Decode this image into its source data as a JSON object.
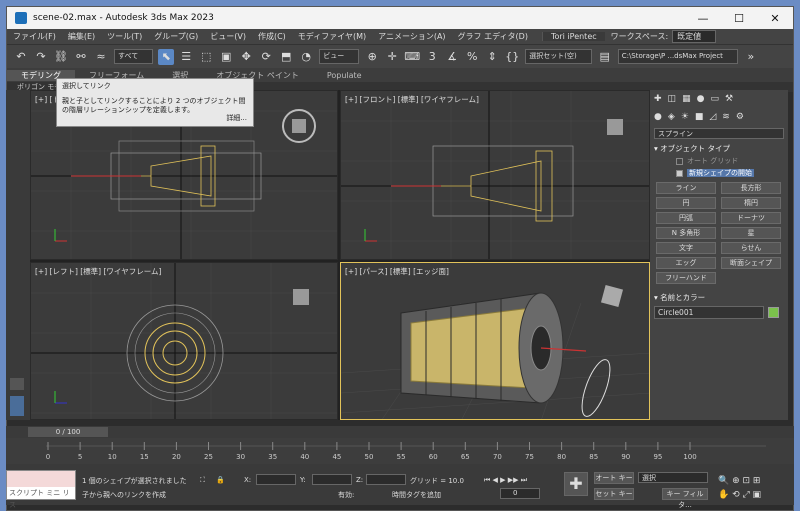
{
  "window": {
    "title": "scene-02.max - Autodesk 3ds Max 2023",
    "controls": [
      "—",
      "☐",
      "✕"
    ]
  },
  "menubar": {
    "items": [
      "ファイル(F)",
      "編集(E)",
      "ツール(T)",
      "グループ(G)",
      "ビュー(V)",
      "作成(C)",
      "モディファイヤ(M)",
      "アニメーション(A)",
      "グラフ エディタ(D)"
    ],
    "user": "Tori iPentec",
    "workspace_label": "ワークスペース:",
    "workspace_value": "既定値"
  },
  "toolbar": {
    "selection_filter": "すべて",
    "view_dropdown": "ビュー",
    "selection_set": "選択セット(空)",
    "project_path": "C:\\Storage\\P ...dsMax Project"
  },
  "ribbon": {
    "tabs": [
      "モデリング",
      "フリーフォーム",
      "選択",
      "オブジェクト ペイント",
      "Populate"
    ],
    "sub": "ポリゴン モデリ"
  },
  "tooltip": {
    "title": "選択してリンク",
    "body": "親と子としてリンクすることにより 2 つのオブジェクト間の階層リレーションシップを定義します。",
    "more": "詳細..."
  },
  "viewports": [
    {
      "label": "[+] [トップ] [標準] [ワイヤフレーム]",
      "cube": "上"
    },
    {
      "label": "[+] [フロント] [標準] [ワイヤフレーム]",
      "cube": "前"
    },
    {
      "label": "[+] [レフト] [標準] [ワイヤフレーム]",
      "cube": "左"
    },
    {
      "label": "[+] [パース] [標準] [エッジ面]",
      "cube": ""
    }
  ],
  "command_panel": {
    "category": "スプライン",
    "rollout_object_type": "オブジェクト タイプ",
    "auto_grid": "オート グリッド",
    "start_new_shape": "新規シェイプの開始",
    "buttons": [
      "ライン",
      "長方形",
      "円",
      "楕円",
      "円弧",
      "ドーナツ",
      "N 多角形",
      "星",
      "文字",
      "らせん",
      "エッグ",
      "断面シェイプ",
      "フリーハンド"
    ],
    "rollout_name_color": "名前とカラー",
    "object_name": "Circle001",
    "object_color": "#7bc14c"
  },
  "timeline": {
    "frame_display": "0 / 100",
    "ticks": [
      "0",
      "5",
      "10",
      "15",
      "20",
      "25",
      "30",
      "35",
      "40",
      "45",
      "50",
      "55",
      "60",
      "65",
      "70",
      "75",
      "80",
      "85",
      "90",
      "95",
      "100"
    ]
  },
  "status": {
    "line1": "1 個のシェイプが選択されました",
    "line2": "子から親へのリンクを作成",
    "x_label": "X:",
    "y_label": "Y:",
    "z_label": "Z:",
    "grid": "グリッド = 10.0",
    "enabled": "有効:",
    "add_time_tag": "時間タグを追加",
    "auto_key": "オート キー",
    "selection": "選択",
    "set_key": "セット キー",
    "key_filter": "キー フィルタ...",
    "frame": "0",
    "script_label": "スクリプト ミニ リス"
  }
}
